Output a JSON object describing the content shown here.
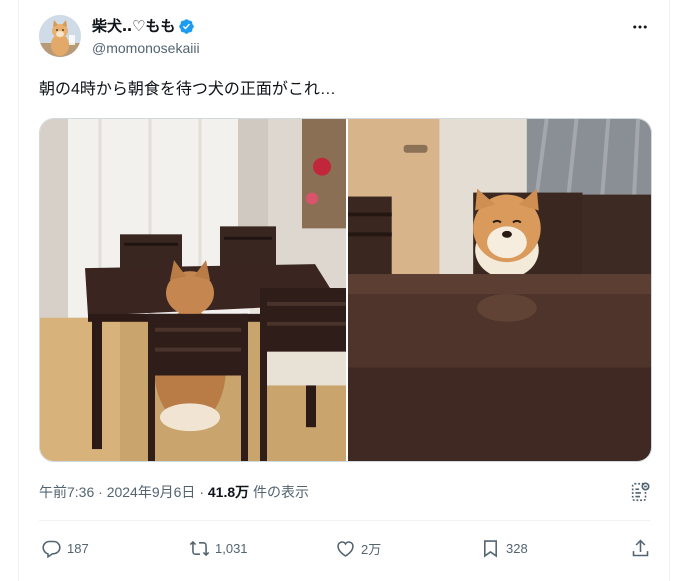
{
  "user": {
    "display_name": "柴犬‥♡もも",
    "handle": "@momonosekaiii",
    "verified_icon": "verified-badge-icon",
    "avatar_icon": "shiba-avatar"
  },
  "tweet": {
    "text": "朝の4時から朝食を待つ犬の正面がこれ…"
  },
  "media": {
    "left_image": "dog-from-behind-at-dining-table",
    "right_image": "dog-facing-camera-at-dining-table"
  },
  "meta": {
    "time": "午前7:36",
    "separator": "·",
    "date": "2024年9月6日",
    "views_count": "41.8万",
    "views_label": "件の表示"
  },
  "actions": {
    "replies": "187",
    "retweets": "1,031",
    "likes": "2万",
    "bookmarks": "328"
  },
  "colors": {
    "accent": "#1d9bf0",
    "secondary_text": "#536471"
  }
}
